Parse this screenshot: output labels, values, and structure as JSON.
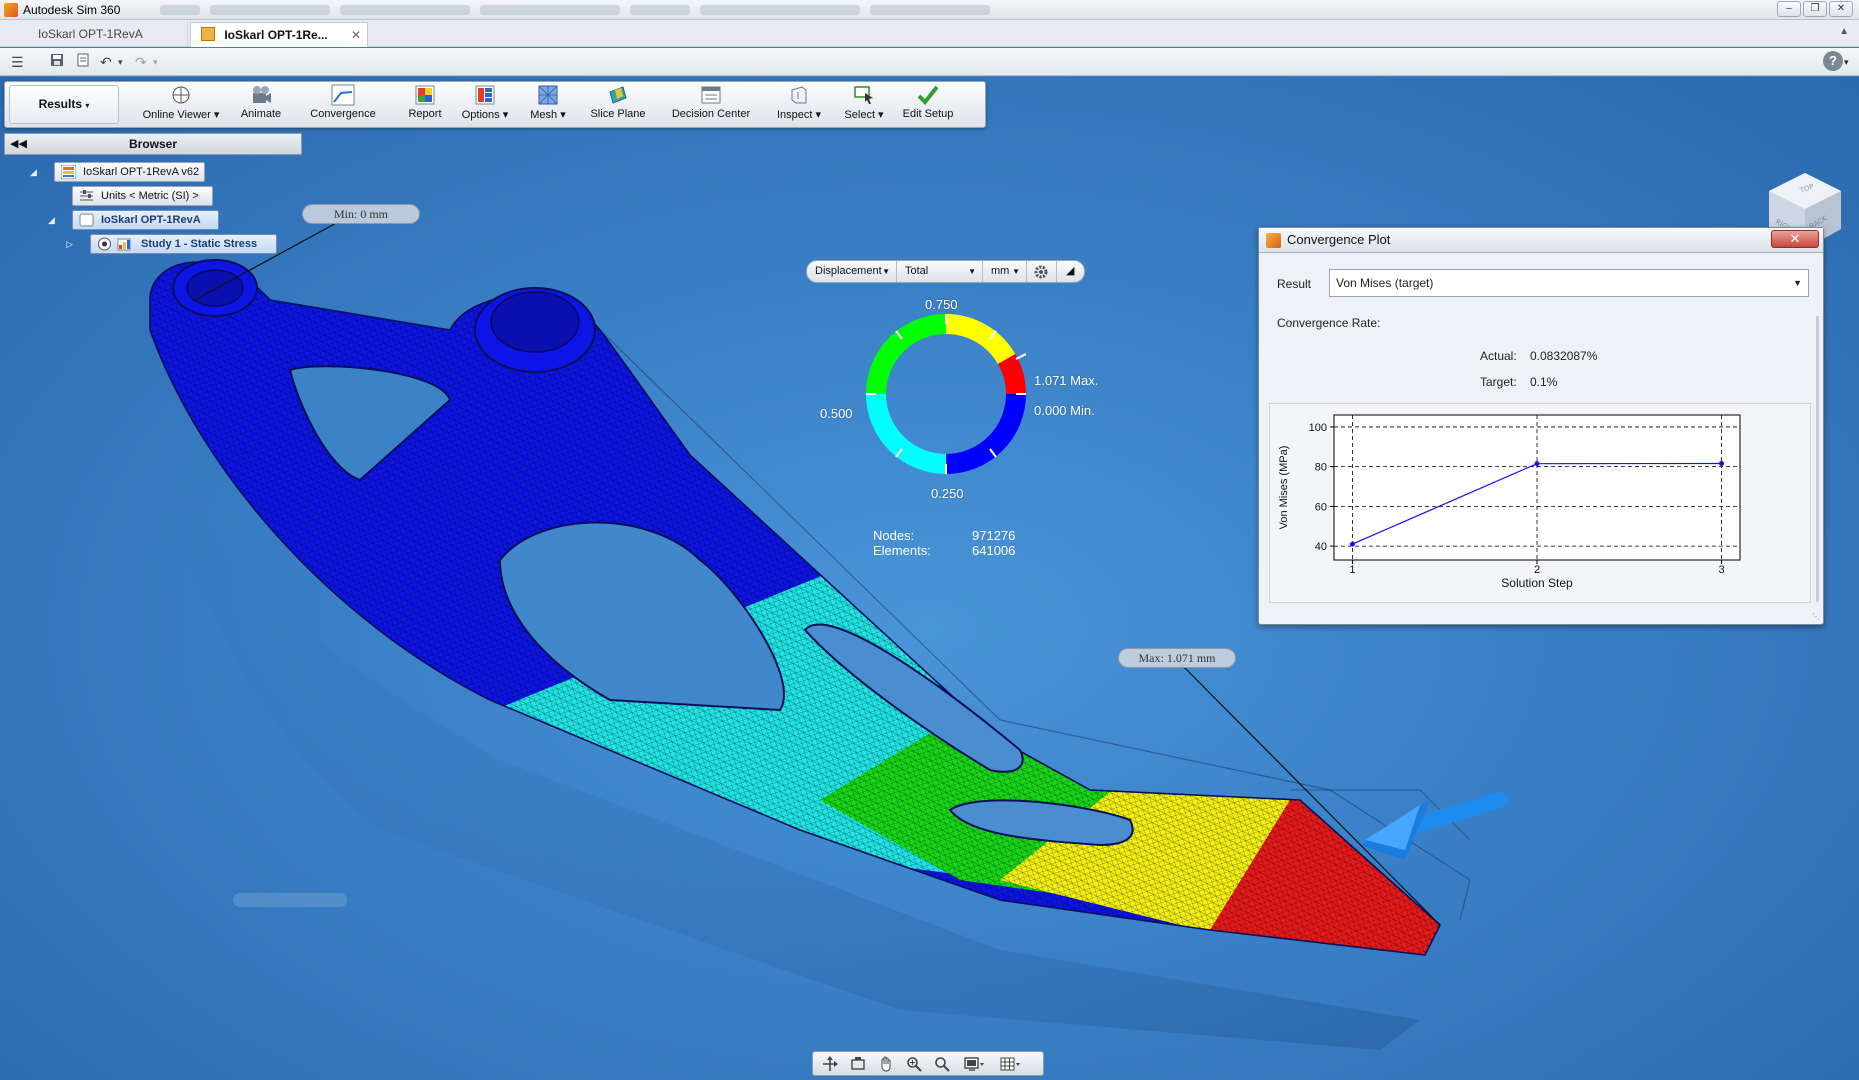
{
  "window": {
    "title": "Autodesk Sim 360",
    "buttons": {
      "minimize": "–",
      "restore": "❐",
      "close": "✕"
    }
  },
  "doc_tabs": [
    {
      "label": "IoSkarl OPT-1RevA"
    },
    {
      "label": "IoSkarl OPT-1Re...",
      "close": "✕"
    }
  ],
  "ribbon": {
    "results": "Results",
    "buttons": [
      {
        "label": "Online Viewer ▾",
        "icon": "online-viewer-icon"
      },
      {
        "label": "Animate",
        "icon": "animate-icon"
      },
      {
        "label": "Convergence",
        "icon": "convergence-icon"
      },
      {
        "label": "Report",
        "icon": "report-icon"
      },
      {
        "label": "Options ▾",
        "icon": "options-icon"
      },
      {
        "label": "Mesh ▾",
        "icon": "mesh-icon"
      },
      {
        "label": "Slice Plane",
        "icon": "slice-plane-icon"
      },
      {
        "label": "Decision Center",
        "icon": "decision-center-icon"
      },
      {
        "label": "Inspect ▾",
        "icon": "inspect-icon"
      },
      {
        "label": "Select ▾",
        "icon": "select-icon"
      },
      {
        "label": "Edit Setup",
        "icon": "check-icon"
      }
    ]
  },
  "browser": {
    "title": "Browser",
    "nodes": [
      {
        "label": "IoSkarl OPT-1RevA v62"
      },
      {
        "label": "Units < Metric (SI) >"
      },
      {
        "label": "IoSkarl OPT-1RevA"
      },
      {
        "label": "Study 1 - Static Stress"
      }
    ]
  },
  "viewport": {
    "min_callout": "Min: 0 mm",
    "max_callout": "Max: 1.071 mm",
    "legend": {
      "result_type": "Displacement",
      "component": "Total",
      "unit": "mm",
      "labels": {
        "top": "0.750",
        "left": "0.500",
        "bottom": "0.250",
        "max": "1.071 Max.",
        "min": "0.000 Min."
      },
      "colors": [
        "#0000ff",
        "#00ffff",
        "#00ff00",
        "#ffff00",
        "#ff0000"
      ]
    },
    "stats": {
      "nodes_label": "Nodes:",
      "nodes_value": "971276",
      "elements_label": "Elements:",
      "elements_value": "641006"
    }
  },
  "convergence_plot": {
    "title": "Convergence Plot",
    "result_label": "Result",
    "result_value": "Von Mises (target)",
    "rate_label": "Convergence Rate:",
    "actual_label": "Actual:",
    "actual_value": "0.0832087%",
    "target_label": "Target:",
    "target_value": "0.1%"
  },
  "chart_data": {
    "type": "line",
    "x": [
      1,
      2,
      3
    ],
    "series": [
      {
        "values": [
          41,
          81.5,
          81.6
        ],
        "color": "#1010ff"
      }
    ],
    "xlabel": "Solution Step",
    "ylabel": "Von Mises (MPa)",
    "xticks": [
      1,
      2,
      3
    ],
    "yticks": [
      40,
      60,
      80,
      100
    ],
    "xlim": [
      0.9,
      3.1
    ],
    "ylim": [
      33,
      106
    ],
    "grid": true
  }
}
